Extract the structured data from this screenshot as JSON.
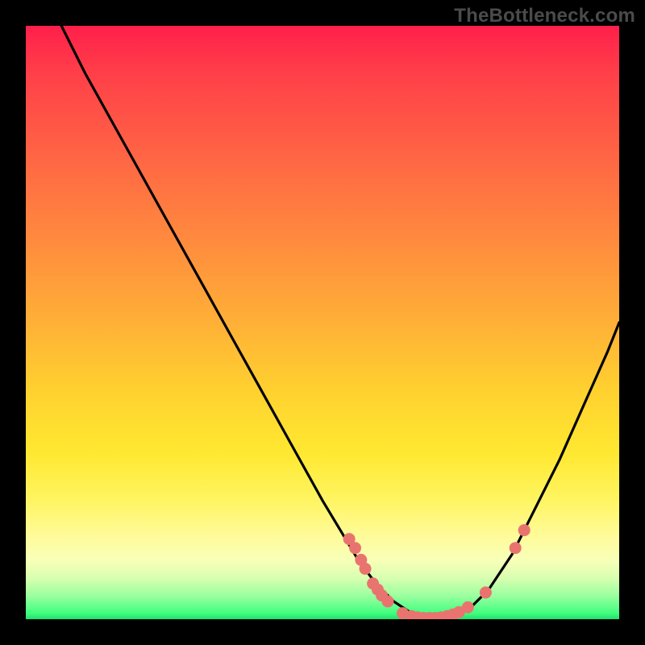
{
  "watermark": "TheBottleneck.com",
  "colors": {
    "background": "#000000",
    "curve": "#000000",
    "dot_fill": "#e9746f",
    "dot_stroke": "#c75a58"
  },
  "chart_data": {
    "type": "line",
    "title": "",
    "xlabel": "",
    "ylabel": "",
    "xlim": [
      0,
      100
    ],
    "ylim": [
      0,
      100
    ],
    "curve": {
      "x": [
        6,
        10,
        15,
        20,
        25,
        30,
        35,
        40,
        45,
        50,
        53,
        56,
        59,
        62,
        65,
        68,
        71,
        73,
        75,
        78,
        82,
        86,
        90,
        94,
        98,
        100
      ],
      "y": [
        100,
        92,
        83,
        74,
        65,
        56,
        47,
        38,
        29,
        20,
        15,
        10,
        6,
        3,
        1,
        0,
        0,
        1,
        2,
        5,
        11,
        19,
        27,
        36,
        45,
        50
      ]
    },
    "series": [
      {
        "name": "dots",
        "points": [
          {
            "x": 54.5,
            "y": 13.5
          },
          {
            "x": 55.5,
            "y": 12.0
          },
          {
            "x": 56.5,
            "y": 10.0
          },
          {
            "x": 57.2,
            "y": 8.5
          },
          {
            "x": 58.5,
            "y": 6.0
          },
          {
            "x": 59.3,
            "y": 5.0
          },
          {
            "x": 60.0,
            "y": 4.0
          },
          {
            "x": 61.0,
            "y": 3.0
          },
          {
            "x": 63.5,
            "y": 1.0
          },
          {
            "x": 65.0,
            "y": 0.5
          },
          {
            "x": 66.0,
            "y": 0.3
          },
          {
            "x": 67.0,
            "y": 0.2
          },
          {
            "x": 68.0,
            "y": 0.2
          },
          {
            "x": 69.0,
            "y": 0.2
          },
          {
            "x": 70.0,
            "y": 0.3
          },
          {
            "x": 71.0,
            "y": 0.5
          },
          {
            "x": 72.0,
            "y": 0.8
          },
          {
            "x": 73.0,
            "y": 1.2
          },
          {
            "x": 74.5,
            "y": 2.0
          },
          {
            "x": 77.5,
            "y": 4.5
          },
          {
            "x": 82.5,
            "y": 12.0
          },
          {
            "x": 84.0,
            "y": 15.0
          }
        ]
      }
    ]
  }
}
